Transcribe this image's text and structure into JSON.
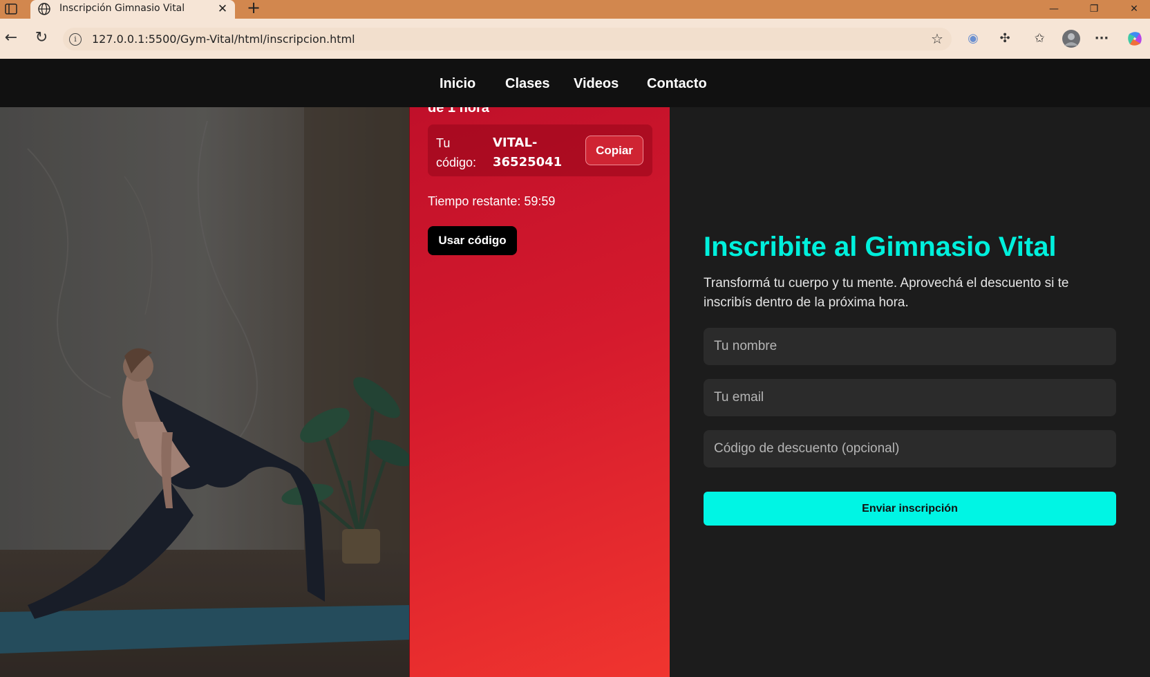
{
  "browser": {
    "tab_title": "Inscripción Gimnasio Vital",
    "url": "127.0.0.1:5500/Gym-Vital/html/inscripcion.html"
  },
  "nav": {
    "items": [
      "Inicio",
      "Clases",
      "Videos",
      "Contacto"
    ]
  },
  "promo": {
    "clipped_heading": "de 1 hora",
    "code_label": "Tu código:",
    "code_value": "VITAL-36525041",
    "copy_label": "Copiar",
    "timer_text": "Tiempo restante: 59:59",
    "use_code_label": "Usar código"
  },
  "form": {
    "title": "Inscribite al Gimnasio Vital",
    "subtitle": "Transformá tu cuerpo y tu mente. Aprovechá el descuento si te inscribís dentro de la próxima hora.",
    "name_placeholder": "Tu nombre",
    "email_placeholder": "Tu email",
    "code_placeholder": "Código de descuento (opcional)",
    "submit_label": "Enviar inscripción"
  },
  "colors": {
    "accent": "#00f0dc",
    "promo_red": "#d51a2d",
    "nav_bg": "#111111",
    "browser_frame": "#d2874e"
  }
}
